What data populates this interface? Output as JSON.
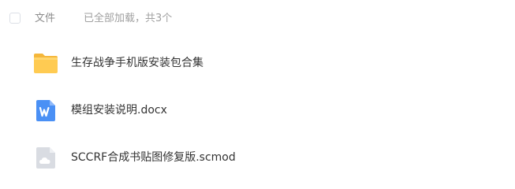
{
  "header": {
    "column_label": "文件",
    "status_text": "已全部加载，共3个"
  },
  "files": [
    {
      "name": "生存战争手机版安装包合集",
      "icon": "folder-icon",
      "color": "#FFC94D"
    },
    {
      "name": "模组安装说明.docx",
      "icon": "word-doc-icon",
      "color": "#4A90F5"
    },
    {
      "name": "SCCRF合成书贴图修复版.scmod",
      "icon": "cloud-file-icon",
      "color": "#D3D7DE"
    }
  ]
}
